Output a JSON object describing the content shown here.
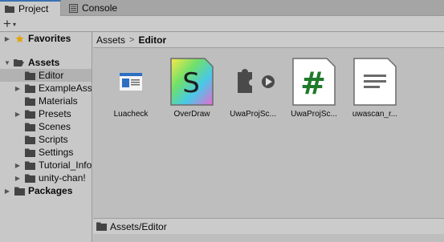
{
  "tabs": {
    "project_label": "Project",
    "console_label": "Console"
  },
  "toolbar": {
    "add_label": "+",
    "add_caret": "▾"
  },
  "sidebar": {
    "favorites": "Favorites",
    "assets": "Assets",
    "items": [
      {
        "label": "Editor"
      },
      {
        "label": "ExampleAss"
      },
      {
        "label": "Materials"
      },
      {
        "label": "Presets"
      },
      {
        "label": "Scenes"
      },
      {
        "label": "Scripts"
      },
      {
        "label": "Settings"
      },
      {
        "label": "Tutorial_Info"
      },
      {
        "label": "unity-chan!"
      }
    ],
    "packages": "Packages"
  },
  "breadcrumb": {
    "root": "Assets",
    "separator": ">",
    "current": "Editor"
  },
  "assets": [
    {
      "label": "Luacheck",
      "icon": "executable-icon"
    },
    {
      "label": "OverDraw",
      "icon": "shader-icon"
    },
    {
      "label": "UwaProjSc...",
      "icon": "plugin-icon"
    },
    {
      "label": "UwaProjSc...",
      "icon": "csharp-script-icon"
    },
    {
      "label": "uwascan_r...",
      "icon": "text-file-icon"
    }
  ],
  "status": {
    "path": "Assets/Editor"
  },
  "colors": {
    "accent": "#3a72b0",
    "selection": "#b2b2b2",
    "csharp": "#1f7a2a",
    "favorite_star": "#e0a400"
  }
}
